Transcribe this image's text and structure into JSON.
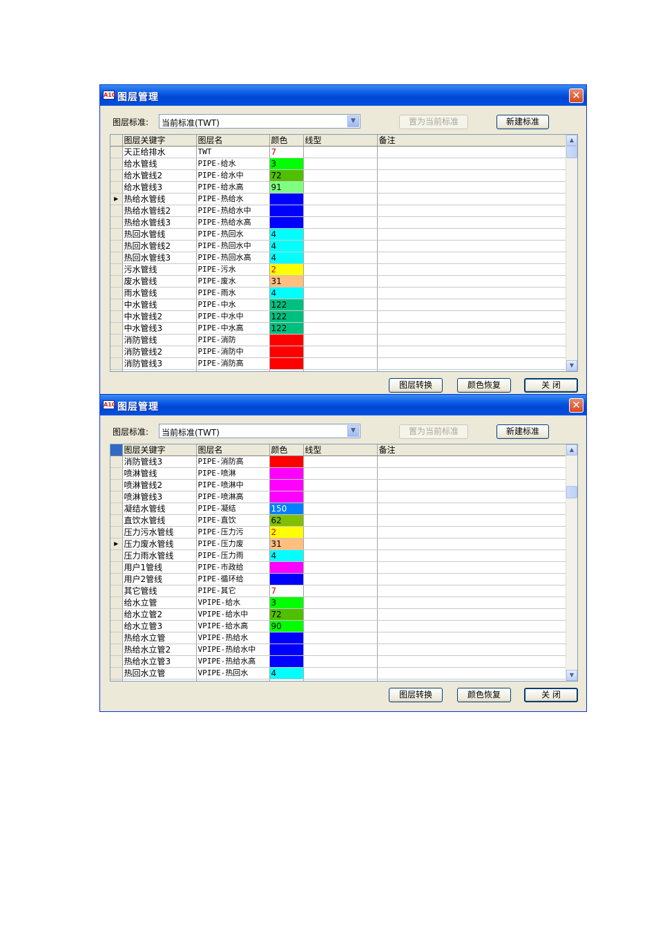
{
  "windows": [
    {
      "title": "图层管理",
      "icon_text": "A10",
      "close_glyph": "✕",
      "standard_label": "图层标准:",
      "standard_value": "当前标准(TWT)",
      "dropdown_glyph": "▼",
      "set_current_label": "置为当前标准",
      "new_standard_label": "新建标准",
      "columns": [
        "图层关键字",
        "图层名",
        "颜色",
        "线型",
        "备注"
      ],
      "pointer_glyph": "▶",
      "scroll_up": "▲",
      "scroll_down": "▼",
      "scroll_position": 0.0,
      "selected_row_index": 4,
      "rows": [
        {
          "key": "天正给排水",
          "name": "TWT",
          "color": "7",
          "hex": "#ffffff",
          "text": "#cc0000"
        },
        {
          "key": "给水管线",
          "name": "PIPE-给水",
          "color": "3",
          "hex": "#00ff00",
          "text": "#000000"
        },
        {
          "key": "给水管线2",
          "name": "PIPE-给水中",
          "color": "72",
          "hex": "#4fc000",
          "text": "#000000"
        },
        {
          "key": "给水管线3",
          "name": "PIPE-给水高",
          "color": "91",
          "hex": "#7fff7f",
          "text": "#000000"
        },
        {
          "key": "热给水管线",
          "name": "PIPE-热给水",
          "color": "5",
          "hex": "#0000ff",
          "text": "#0000ff"
        },
        {
          "key": "热给水管线2",
          "name": "PIPE-热给水中",
          "color": "5",
          "hex": "#0000ff",
          "text": "#0000ff"
        },
        {
          "key": "热给水管线3",
          "name": "PIPE-热给水高",
          "color": "5",
          "hex": "#0000ff",
          "text": "#0000ff"
        },
        {
          "key": "热回水管线",
          "name": "PIPE-热回水",
          "color": "4",
          "hex": "#00ffff",
          "text": "#000000"
        },
        {
          "key": "热回水管线2",
          "name": "PIPE-热回水中",
          "color": "4",
          "hex": "#00ffff",
          "text": "#000000"
        },
        {
          "key": "热回水管线3",
          "name": "PIPE-热回水高",
          "color": "4",
          "hex": "#00ffff",
          "text": "#000000"
        },
        {
          "key": "污水管线",
          "name": "PIPE-污水",
          "color": "2",
          "hex": "#ffff00",
          "text": "#cc0000"
        },
        {
          "key": "废水管线",
          "name": "PIPE-废水",
          "color": "31",
          "hex": "#ffbf7f",
          "text": "#000000"
        },
        {
          "key": "雨水管线",
          "name": "PIPE-雨水",
          "color": "4",
          "hex": "#00ffff",
          "text": "#000000"
        },
        {
          "key": "中水管线",
          "name": "PIPE-中水",
          "color": "122",
          "hex": "#00c080",
          "text": "#000000"
        },
        {
          "key": "中水管线2",
          "name": "PIPE-中水中",
          "color": "122",
          "hex": "#00c080",
          "text": "#000000"
        },
        {
          "key": "中水管线3",
          "name": "PIPE-中水高",
          "color": "122",
          "hex": "#00c080",
          "text": "#000000"
        },
        {
          "key": "消防管线",
          "name": "PIPE-消防",
          "color": "1",
          "hex": "#ff0000",
          "text": "#ff0000"
        },
        {
          "key": "消防管线2",
          "name": "PIPE-消防中",
          "color": "1",
          "hex": "#ff0000",
          "text": "#ff0000"
        },
        {
          "key": "消防管线3",
          "name": "PIPE-消防高",
          "color": "1",
          "hex": "#ff0000",
          "text": "#ff0000"
        }
      ],
      "convert_label": "图层转换",
      "restore_label": "颜色恢复",
      "close_label": "关 闭"
    },
    {
      "title": "图层管理",
      "icon_text": "A10",
      "close_glyph": "✕",
      "standard_label": "图层标准:",
      "standard_value": "当前标准(TWT)",
      "dropdown_glyph": "▼",
      "set_current_label": "置为当前标准",
      "new_standard_label": "新建标准",
      "columns": [
        "图层关键字",
        "图层名",
        "颜色",
        "线型",
        "备注"
      ],
      "pointer_glyph": "▶",
      "scroll_up": "▲",
      "scroll_down": "▼",
      "scroll_position": 0.15,
      "selected_row_index": 7,
      "rows": [
        {
          "key": "消防管线3",
          "name": "PIPE-消防高",
          "color": "1",
          "hex": "#ff0000",
          "text": "#ff0000"
        },
        {
          "key": "喷淋管线",
          "name": "PIPE-喷淋",
          "color": "6",
          "hex": "#ff00ff",
          "text": "#ff00ff"
        },
        {
          "key": "喷淋管线2",
          "name": "PIPE-喷淋中",
          "color": "6",
          "hex": "#ff00ff",
          "text": "#ff00ff"
        },
        {
          "key": "喷淋管线3",
          "name": "PIPE-喷淋高",
          "color": "6",
          "hex": "#ff00ff",
          "text": "#ff00ff"
        },
        {
          "key": "凝结水管线",
          "name": "PIPE-凝结",
          "color": "150",
          "hex": "#0080ff",
          "text": "#ffffff"
        },
        {
          "key": "直饮水管线",
          "name": "PIPE-直饮",
          "color": "62",
          "hex": "#80c000",
          "text": "#000000"
        },
        {
          "key": "压力污水管线",
          "name": "PIPE-压力污",
          "color": "2",
          "hex": "#ffff00",
          "text": "#cc0000"
        },
        {
          "key": "压力废水管线",
          "name": "PIPE-压力废",
          "color": "31",
          "hex": "#ffbf7f",
          "text": "#000000"
        },
        {
          "key": "压力雨水管线",
          "name": "PIPE-压力雨",
          "color": "4",
          "hex": "#00ffff",
          "text": "#000000"
        },
        {
          "key": "用户1管线",
          "name": "PIPE-市政给",
          "color": "6",
          "hex": "#ff00ff",
          "text": "#ff00ff"
        },
        {
          "key": "用户2管线",
          "name": "PIPE-循环给",
          "color": "5",
          "hex": "#0000ff",
          "text": "#0000ff"
        },
        {
          "key": "其它管线",
          "name": "PIPE-其它",
          "color": "7",
          "hex": "#ffffff",
          "text": "#cc0000"
        },
        {
          "key": "给水立管",
          "name": "VPIPE-给水",
          "color": "3",
          "hex": "#00ff00",
          "text": "#000000"
        },
        {
          "key": "给水立管2",
          "name": "VPIPE-给水中",
          "color": "72",
          "hex": "#4fc000",
          "text": "#000000"
        },
        {
          "key": "给水立管3",
          "name": "VPIPE-给水高",
          "color": "90",
          "hex": "#00ff00",
          "text": "#000000"
        },
        {
          "key": "热给水立管",
          "name": "VPIPE-热给水",
          "color": "5",
          "hex": "#0000ff",
          "text": "#0000ff"
        },
        {
          "key": "热给水立管2",
          "name": "VPIPE-热给水中",
          "color": "5",
          "hex": "#0000ff",
          "text": "#0000ff"
        },
        {
          "key": "热给水立管3",
          "name": "VPIPE-热给水高",
          "color": "5",
          "hex": "#0000ff",
          "text": "#0000ff"
        },
        {
          "key": "热回水立管",
          "name": "VPIPE-热回水",
          "color": "4",
          "hex": "#00ffff",
          "text": "#000000"
        }
      ],
      "convert_label": "图层转换",
      "restore_label": "颜色恢复",
      "close_label": "关 闭"
    }
  ]
}
